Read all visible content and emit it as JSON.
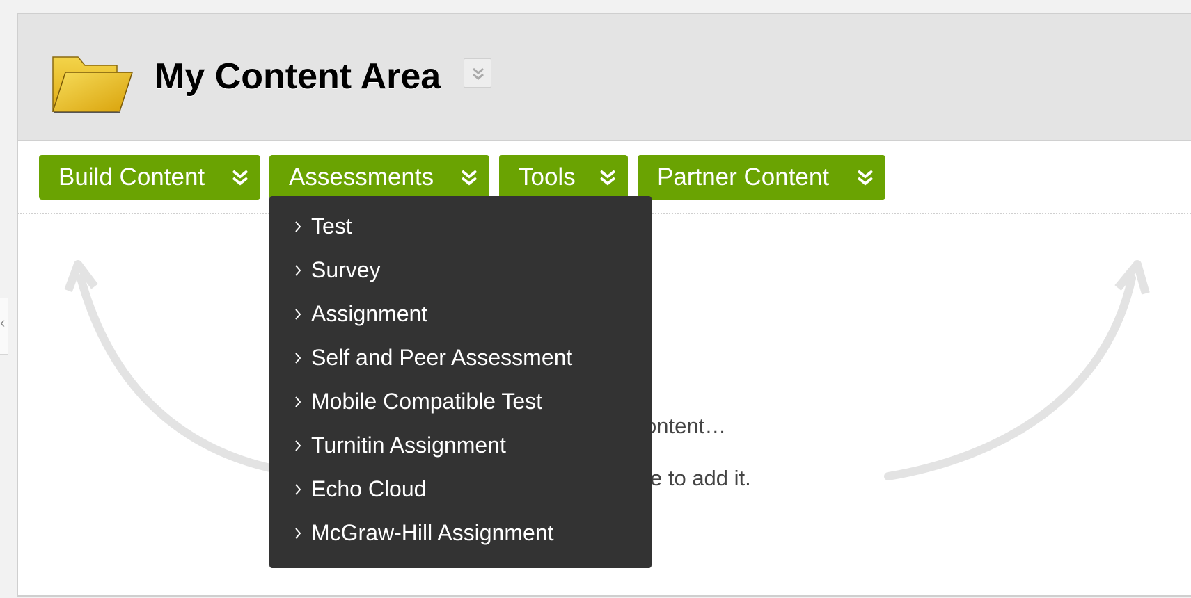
{
  "page": {
    "title": "My Content Area",
    "accent_color": "#6aa302",
    "title_icon": "folder-icon",
    "title_menu_icon": "double-chevron-down-icon"
  },
  "toolbar": {
    "buttons": [
      {
        "label": "Build Content",
        "icon": "double-chevron-down-icon"
      },
      {
        "label": "Assessments",
        "icon": "double-chevron-down-icon",
        "expanded": true
      },
      {
        "label": "Tools",
        "icon": "double-chevron-down-icon"
      },
      {
        "label": "Partner Content",
        "icon": "double-chevron-down-icon"
      }
    ]
  },
  "assessments_menu": {
    "items": [
      {
        "label": "Test"
      },
      {
        "label": "Survey"
      },
      {
        "label": "Assignment"
      },
      {
        "label": "Self and Peer Assessment"
      },
      {
        "label": "Mobile Compatible Test"
      },
      {
        "label": "Turnitin Assignment"
      },
      {
        "label": "Echo Cloud"
      },
      {
        "label": "McGraw-Hill Assignment"
      }
    ]
  },
  "empty_state": {
    "line1_visible": "ontent…",
    "line2_visible": "e to add it."
  }
}
